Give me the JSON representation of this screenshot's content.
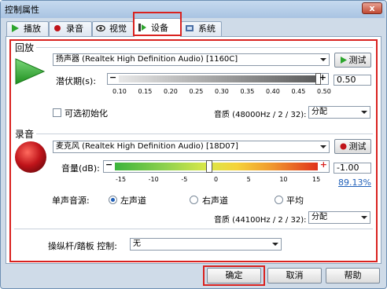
{
  "window": {
    "title": "控制属性",
    "close_glyph": "x"
  },
  "tabs": [
    {
      "label": "播放",
      "icon": "play-icon"
    },
    {
      "label": "录音",
      "icon": "record-icon"
    },
    {
      "label": "视觉",
      "icon": "eye-icon"
    },
    {
      "label": "设备",
      "icon": "device-icon",
      "active": true
    },
    {
      "label": "系统",
      "icon": "system-icon"
    }
  ],
  "playback": {
    "group_label": "回放",
    "device": "扬声器 (Realtek High Definition Audio) [1160C]",
    "test_label": "测试",
    "latency_label": "潜伏期(s):",
    "latency_value": "0.50",
    "latency_fraction": 1.0,
    "latency_ticks": [
      "0.10",
      "0.15",
      "0.20",
      "0.25",
      "0.30",
      "0.35",
      "0.40",
      "0.45",
      "0.50"
    ],
    "init_label": "可选初始化",
    "quality_label": "音质 (48000Hz / 2 / 32):",
    "quality_value": "分配"
  },
  "recording": {
    "group_label": "录音",
    "device": "麦克风 (Realtek High Definition Audio) [18D07]",
    "test_label": "测试",
    "volume_label": "音量(dB):",
    "volume_value": "-1.00",
    "volume_percent": "89.13%",
    "volume_ticks": [
      "-15",
      "-10",
      "-5",
      "0",
      "5",
      "10",
      "15"
    ],
    "mono_label": "单声音源:",
    "mono_options": [
      "左声道",
      "右声道",
      "平均"
    ],
    "mono_selected": 0,
    "quality_label": "音质 (44100Hz / 2 / 32):",
    "quality_value": "分配"
  },
  "joystick": {
    "label": "操纵杆/踏板 控制:",
    "value": "无"
  },
  "footer": {
    "ok": "确定",
    "cancel": "取消",
    "help": "帮助"
  },
  "colors": {
    "accent_red": "#d9221f",
    "play_green": "#2da52d",
    "record_red": "#c0141a",
    "link_blue": "#1f5fb8"
  }
}
